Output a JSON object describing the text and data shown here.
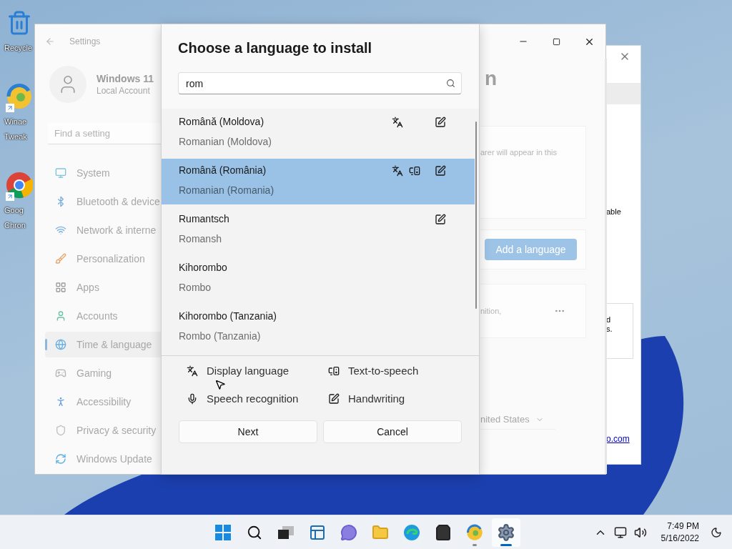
{
  "desktop": {
    "icons": [
      {
        "kind": "recycle",
        "shortcut": false,
        "lines": [
          "Recycle"
        ]
      },
      {
        "kind": "swirl",
        "shortcut": true,
        "lines": [
          "Winae",
          "Tweak"
        ]
      },
      {
        "kind": "browser",
        "shortcut": true,
        "lines": [
          "Goog",
          "Chron"
        ]
      }
    ]
  },
  "back_window": {
    "fragment_1": "able",
    "fragment_2": "d",
    "fragment_3": "s.",
    "link": "o.com"
  },
  "settings": {
    "title": "Settings",
    "account": {
      "name": "Windows 11",
      "type": "Local Account"
    },
    "search": {
      "placeholder": "Find a setting"
    },
    "nav": [
      {
        "kind": "system",
        "label": "System",
        "selected": false
      },
      {
        "kind": "bluetooth",
        "label": "Bluetooth & device",
        "selected": false
      },
      {
        "kind": "network",
        "label": "Network & interne",
        "selected": false
      },
      {
        "kind": "personalization",
        "label": "Personalization",
        "selected": false
      },
      {
        "kind": "apps",
        "label": "Apps",
        "selected": false
      },
      {
        "kind": "accounts",
        "label": "Accounts",
        "selected": false
      },
      {
        "kind": "time",
        "label": "Time & language",
        "selected": true
      },
      {
        "kind": "gaming",
        "label": "Gaming",
        "selected": false
      },
      {
        "kind": "accessibility",
        "label": "Accessibility",
        "selected": false
      },
      {
        "kind": "privacy",
        "label": "Privacy & security",
        "selected": false
      },
      {
        "kind": "update",
        "label": "Windows Update",
        "selected": false
      }
    ],
    "content": {
      "heading": "n",
      "card_text": "arer will appear in this",
      "button": "Add a language",
      "row_text": "nition,",
      "dropdown": "nited States"
    }
  },
  "dialog": {
    "title": "Choose a language to install",
    "search": {
      "value": "rom"
    },
    "languages": [
      {
        "native": "Română (Moldova)",
        "english": "Romanian (Moldova)",
        "display": true,
        "tts": false,
        "handwriting": true,
        "selected": false
      },
      {
        "native": "Română (România)",
        "english": "Romanian (Romania)",
        "display": true,
        "tts": true,
        "handwriting": true,
        "selected": true
      },
      {
        "native": "Rumantsch",
        "english": "Romansh",
        "display": false,
        "tts": false,
        "handwriting": true,
        "selected": false
      },
      {
        "native": "Kihorombo",
        "english": "Rombo",
        "display": false,
        "tts": false,
        "handwriting": false,
        "selected": false
      },
      {
        "native": "Kihorombo (Tanzania)",
        "english": "Rombo (Tanzania)",
        "display": false,
        "tts": false,
        "handwriting": false,
        "selected": false
      }
    ],
    "features": [
      {
        "kind": "display",
        "label": "Display language"
      },
      {
        "kind": "tts",
        "label": "Text-to-speech"
      },
      {
        "kind": "speech",
        "label": "Speech recognition"
      },
      {
        "kind": "handwriting",
        "label": "Handwriting"
      }
    ],
    "buttons": [
      "Next",
      "Cancel"
    ]
  },
  "taskbar": {
    "apps": [
      {
        "kind": "start",
        "open": false,
        "selected": false
      },
      {
        "kind": "search",
        "open": false,
        "selected": false
      },
      {
        "kind": "taskview",
        "open": false,
        "selected": false
      },
      {
        "kind": "widgets",
        "open": false,
        "selected": false
      },
      {
        "kind": "chat",
        "open": false,
        "selected": false
      },
      {
        "kind": "explorer",
        "open": false,
        "selected": false
      },
      {
        "kind": "edge",
        "open": false,
        "selected": false
      },
      {
        "kind": "store",
        "open": false,
        "selected": false
      },
      {
        "kind": "swirl",
        "open": true,
        "selected": false
      },
      {
        "kind": "settings",
        "open": true,
        "selected": true
      }
    ],
    "time": "7:49 PM",
    "date": "5/16/2022"
  }
}
